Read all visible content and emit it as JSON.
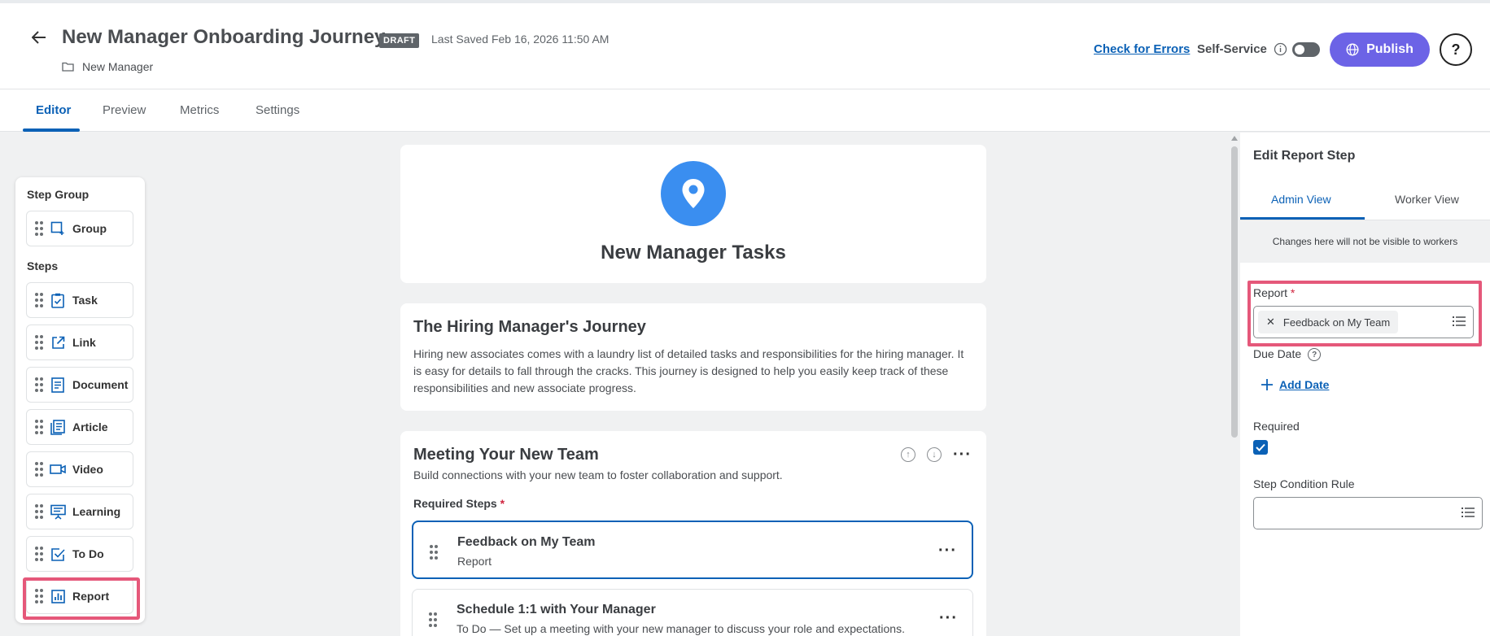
{
  "header": {
    "title": "New Manager Onboarding Journey",
    "status_badge": "DRAFT",
    "last_saved": "Last Saved Feb 16, 2026 11:50 AM",
    "folder": "New Manager",
    "check_errors": "Check for Errors",
    "self_service": "Self-Service",
    "publish": "Publish",
    "help": "?"
  },
  "tabs": [
    {
      "label": "Editor",
      "active": true
    },
    {
      "label": "Preview"
    },
    {
      "label": "Metrics"
    },
    {
      "label": "Settings"
    }
  ],
  "palette": {
    "step_group_heading": "Step Group",
    "steps_heading": "Steps",
    "group": {
      "label": "Group",
      "icon": "group-icon"
    },
    "items": [
      {
        "label": "Task",
        "icon": "task-icon"
      },
      {
        "label": "Link",
        "icon": "link-icon"
      },
      {
        "label": "Document",
        "icon": "document-icon"
      },
      {
        "label": "Article",
        "icon": "article-icon"
      },
      {
        "label": "Video",
        "icon": "video-icon"
      },
      {
        "label": "Learning",
        "icon": "learning-icon"
      },
      {
        "label": "To Do",
        "icon": "todo-icon"
      },
      {
        "label": "Report",
        "icon": "report-icon"
      }
    ]
  },
  "main": {
    "hero_title": "New Manager Tasks",
    "journey_title": "The Hiring Manager's Journey",
    "journey_desc": "Hiring new associates comes with a laundry list of detailed tasks and responsibilities for the hiring manager. It is easy for details to fall through the cracks. This journey is designed to help you easily keep track of these responsibilities and new associate progress.",
    "group": {
      "title": "Meeting Your New Team",
      "desc": "Build connections with your new team to foster collaboration and support.",
      "required_label": "Required Steps",
      "required_star": "*",
      "steps": [
        {
          "title": "Feedback on My Team",
          "sub": "Report"
        },
        {
          "title": "Schedule 1:1 with Your Manager",
          "sub": "To Do — Set up a meeting with your new manager to discuss your role and expectations."
        }
      ]
    }
  },
  "panel": {
    "title": "Edit Report Step",
    "tab_admin": "Admin View",
    "tab_worker": "Worker View",
    "notice": "Changes here will not be visible to workers",
    "report_label": "Report",
    "report_star": "*",
    "report_value": "Feedback on My Team",
    "due_date_label": "Due Date",
    "add_date": "Add Date",
    "required_label": "Required",
    "required_checked": true,
    "condition_label": "Step Condition Rule"
  },
  "colors": {
    "accent": "#0b61b6",
    "publish": "#6c63e6",
    "highlight": "#e5587a",
    "hero": "#3a8ef0"
  }
}
